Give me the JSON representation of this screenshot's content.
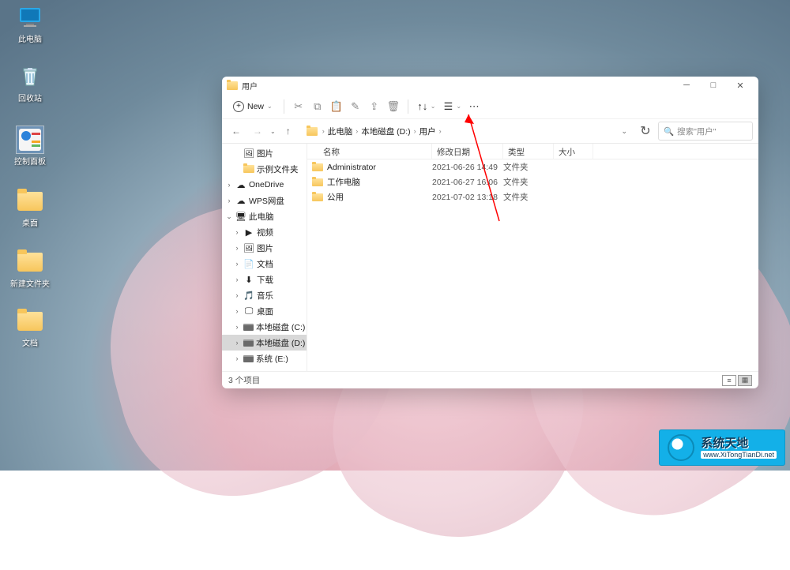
{
  "desktop_icons": [
    {
      "label": "此电脑",
      "kind": "pc"
    },
    {
      "label": "回收站",
      "kind": "recycle"
    },
    {
      "label": "控制面板",
      "kind": "cpanel",
      "selected": true
    },
    {
      "label": "桌面",
      "kind": "folder"
    },
    {
      "label": "新建文件夹",
      "kind": "folder"
    },
    {
      "label": "文档",
      "kind": "folder"
    }
  ],
  "window": {
    "title": "用户",
    "min": "─",
    "max": "□",
    "close": "✕",
    "toolbar": {
      "new_label": "New"
    },
    "breadcrumbs": {
      "b1": "此电脑",
      "b2": "本地磁盘 (D:)",
      "b3": "用户"
    },
    "search_placeholder": "搜索\"用户\"",
    "cols": {
      "name": "名称",
      "date": "修改日期",
      "type": "类型",
      "size": "大小"
    },
    "sidebar": [
      {
        "chev": "",
        "icon": "pictures",
        "label": "图片",
        "indent": 1
      },
      {
        "chev": "",
        "icon": "folder",
        "label": "示例文件夹",
        "indent": 1
      },
      {
        "chev": "›",
        "icon": "cloud",
        "label": "OneDrive",
        "indent": 0
      },
      {
        "chev": "›",
        "icon": "cloud",
        "label": "WPS网盘",
        "indent": 0
      },
      {
        "chev": "⌄",
        "icon": "pc",
        "label": "此电脑",
        "indent": 0
      },
      {
        "chev": "›",
        "icon": "video",
        "label": "视频",
        "indent": 1
      },
      {
        "chev": "›",
        "icon": "pictures",
        "label": "图片",
        "indent": 1
      },
      {
        "chev": "›",
        "icon": "docs",
        "label": "文档",
        "indent": 1
      },
      {
        "chev": "›",
        "icon": "download",
        "label": "下载",
        "indent": 1
      },
      {
        "chev": "›",
        "icon": "music",
        "label": "音乐",
        "indent": 1
      },
      {
        "chev": "›",
        "icon": "desktop",
        "label": "桌面",
        "indent": 1
      },
      {
        "chev": "›",
        "icon": "drive",
        "label": "本地磁盘 (C:)",
        "indent": 1
      },
      {
        "chev": "›",
        "icon": "drive",
        "label": "本地磁盘 (D:)",
        "indent": 1,
        "selected": true
      },
      {
        "chev": "›",
        "icon": "drive",
        "label": "系统 (E:)",
        "indent": 1
      }
    ],
    "files": [
      {
        "name": "Administrator",
        "date": "2021-06-26 14:49",
        "type": "文件夹"
      },
      {
        "name": "工作电脑",
        "date": "2021-06-27 16:06",
        "type": "文件夹"
      },
      {
        "name": "公用",
        "date": "2021-07-02 13:18",
        "type": "文件夹"
      }
    ],
    "status": "3 个项目"
  },
  "watermark": {
    "line1": "系统天地",
    "line2": "www.XiTongTianDi.net"
  }
}
